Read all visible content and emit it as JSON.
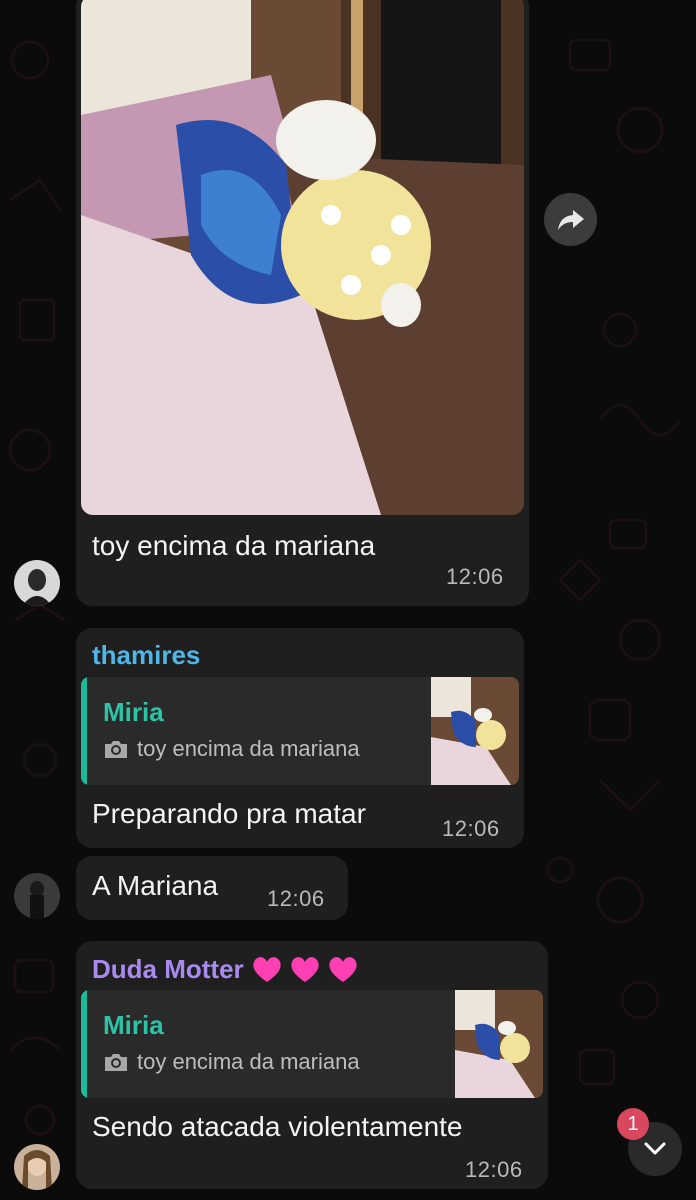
{
  "colors": {
    "background": "#0c0b0c",
    "bubble": "#1f1f1f",
    "quote_bar": "#1fb89b",
    "sender_thamires": "#4fb6e8",
    "sender_duda": "#a98bf0",
    "quote_author": "#2cc3a6",
    "badge": "#d8475e"
  },
  "messages": [
    {
      "id": "photo",
      "caption": "toy encima da mariana",
      "time": "12:06",
      "has_photo": true,
      "forward_icon": "forward-arrow-icon"
    },
    {
      "id": "reply1",
      "sender": "thamires",
      "quote": {
        "author": "Miria",
        "icon": "camera-icon",
        "text": "toy encima da mariana"
      },
      "text": "Preparando pra matar",
      "time": "12:06"
    },
    {
      "id": "plain",
      "text": "A Mariana",
      "time": "12:06"
    },
    {
      "id": "reply2",
      "sender": "Duda Motter",
      "sender_emojis": "heart-icons",
      "quote": {
        "author": "Miria",
        "icon": "camera-icon",
        "text": "toy encima da mariana"
      },
      "text": "Sendo atacada violentamente",
      "time": "12:06"
    }
  ],
  "scroll_button": {
    "icon": "chevron-down-icon",
    "unread": "1"
  }
}
